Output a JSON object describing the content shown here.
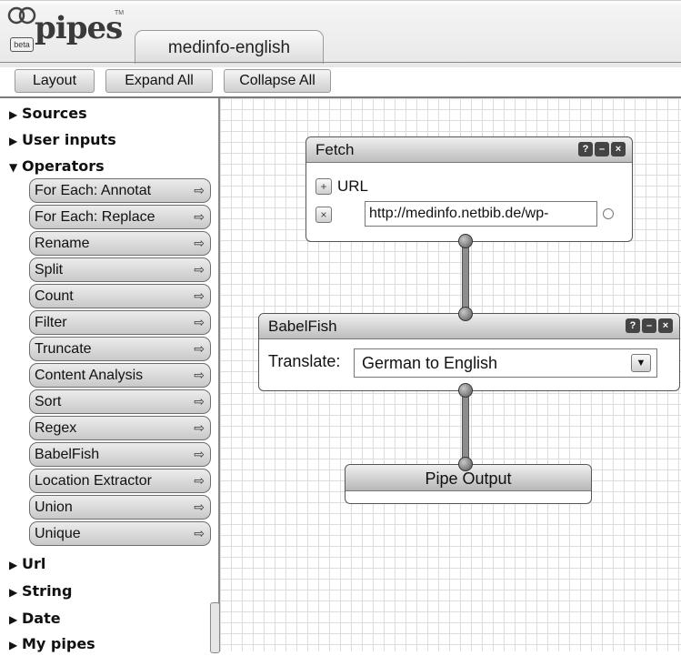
{
  "header": {
    "logo_text": "pipes",
    "logo_badge": "beta",
    "logo_tm": "TM",
    "pipe_name": "medinfo-english"
  },
  "toolbar": {
    "layout_label": "Layout",
    "expand_label": "Expand All",
    "collapse_label": "Collapse All"
  },
  "sidebar": {
    "categories_top": [
      {
        "label": "Sources",
        "expanded": false
      },
      {
        "label": "User inputs",
        "expanded": false
      },
      {
        "label": "Operators",
        "expanded": true
      }
    ],
    "operators": [
      "For Each: Annotat",
      "For Each: Replace",
      "Rename",
      "Split",
      "Count",
      "Filter",
      "Truncate",
      "Content Analysis",
      "Sort",
      "Regex",
      "BabelFish",
      "Location Extractor",
      "Union",
      "Unique"
    ],
    "categories_bottom": [
      {
        "label": "Url",
        "expanded": false
      },
      {
        "label": "String",
        "expanded": false
      },
      {
        "label": "Date",
        "expanded": false
      },
      {
        "label": "My pipes",
        "expanded": false
      }
    ],
    "add_icon": "add-module-icon"
  },
  "canvas": {
    "fetch": {
      "title": "Fetch",
      "url_label": "URL",
      "url_value": "http://medinfo.netbib.de/wp-"
    },
    "babelfish": {
      "title": "BabelFish",
      "translate_label": "Translate:",
      "translate_value": "German to English"
    },
    "output": {
      "title": "Pipe Output"
    },
    "controls": {
      "help": "?",
      "minimize": "–",
      "close": "×"
    }
  }
}
